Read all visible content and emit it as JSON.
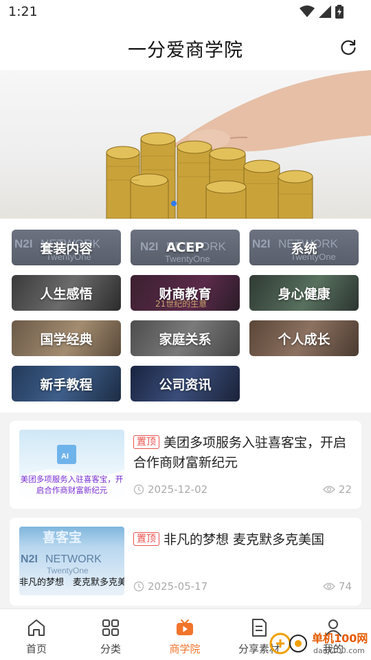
{
  "status": {
    "time": "1:21"
  },
  "header": {
    "title": "一分爱商学院"
  },
  "categories": [
    {
      "label": "套装内容"
    },
    {
      "label": "ACEP"
    },
    {
      "label": "系统"
    },
    {
      "label": "人生感悟"
    },
    {
      "label": "财商教育"
    },
    {
      "label": "身心健康"
    },
    {
      "label": "国学经典"
    },
    {
      "label": "家庭关系"
    },
    {
      "label": "个人成长"
    },
    {
      "label": "新手教程"
    },
    {
      "label": "公司资讯"
    }
  ],
  "articles": [
    {
      "pin": "置顶",
      "title": "美团多项服务入驻喜客宝，开启合作商财富新纪元",
      "date": "2025-12-02",
      "views": "22",
      "thumb_text": "美团多项服务入驻喜客宝，开启合作商财富新纪元"
    },
    {
      "pin": "置顶",
      "title": "非凡的梦想 麦克默多克美国",
      "date": "2025-05-17",
      "views": "74",
      "thumb_text": "非凡的梦想　麦克默多克美"
    }
  ],
  "tile_text": {
    "network": "NETWORK",
    "n21": "N2I",
    "twentyone": "TwentyOne",
    "finance_sub": "21世纪的生意",
    "ai": "AI",
    "xikebao": "喜客宝"
  },
  "nav": [
    {
      "label": "首页",
      "icon": "home-icon"
    },
    {
      "label": "分类",
      "icon": "grid-icon"
    },
    {
      "label": "商学院",
      "icon": "tv-play-icon"
    },
    {
      "label": "分享素材",
      "icon": "document-icon"
    },
    {
      "label": "我的",
      "icon": "user-icon"
    }
  ],
  "active_nav": "商学院",
  "colors": {
    "accent": "#f2742b",
    "pin": "#e9534f",
    "dot": "#2f7bf0"
  },
  "watermark": {
    "title": "单机100网",
    "url": "danji100.com"
  }
}
